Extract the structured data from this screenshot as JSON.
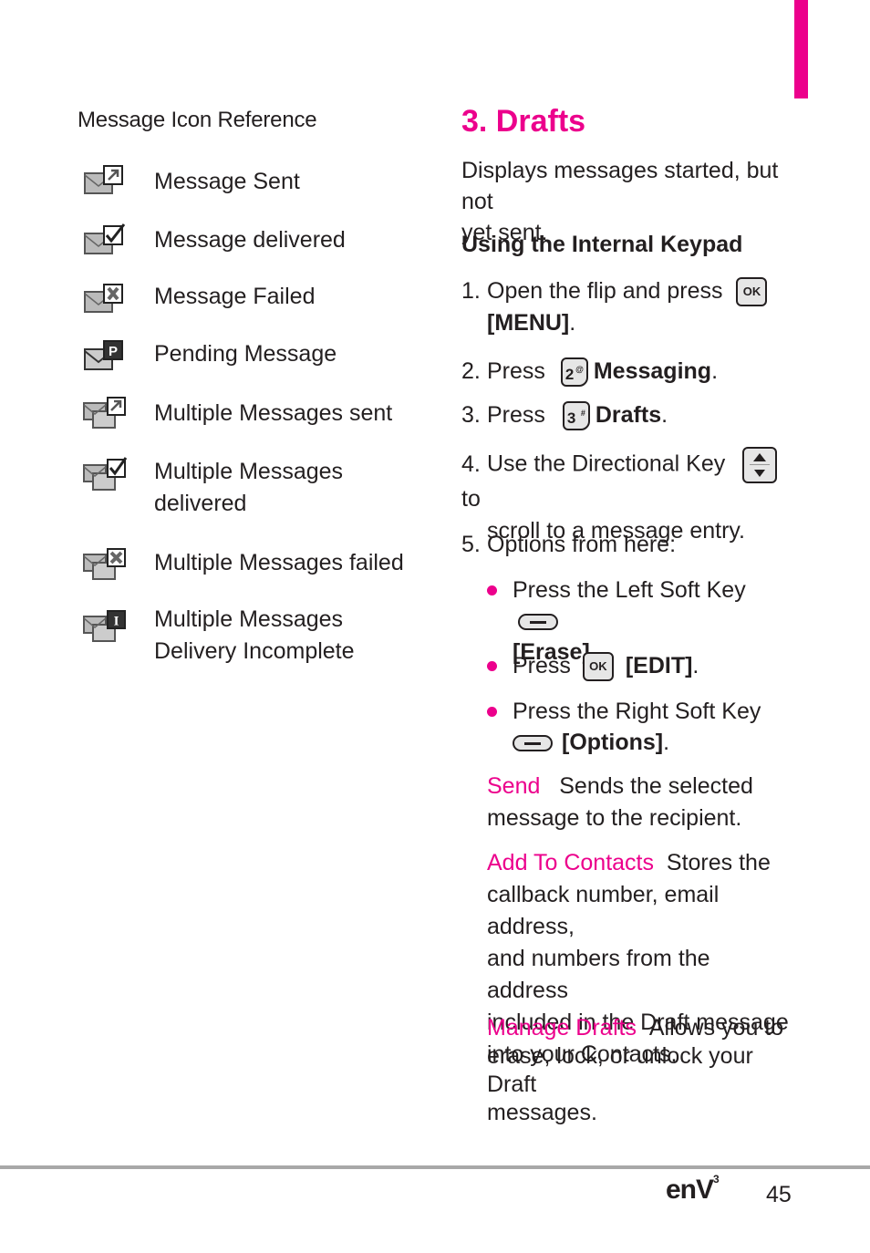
{
  "left": {
    "heading": "Message Icon Reference",
    "icons": [
      {
        "icon": "message-sent-icon",
        "label": "Message Sent"
      },
      {
        "icon": "message-delivered-icon",
        "label": "Message delivered"
      },
      {
        "icon": "message-failed-icon",
        "label": "Message Failed"
      },
      {
        "icon": "pending-message-icon",
        "label": "Pending Message"
      },
      {
        "icon": "multiple-messages-sent-icon",
        "label": "Multiple Messages sent"
      },
      {
        "icon": "multiple-messages-delivered-icon",
        "label_line1": "Multiple Messages",
        "label_line2": "delivered"
      },
      {
        "icon": "multiple-messages-failed-icon",
        "label": "Multiple Messages failed"
      },
      {
        "icon": "multiple-messages-incomplete-icon",
        "label_line1": "Multiple Messages",
        "label_line2": "Delivery Incomplete"
      }
    ]
  },
  "right": {
    "title": "3. Drafts",
    "intro_line1": "Displays messages started, but not",
    "intro_line2": "yet sent.",
    "subheading": "Using the Internal Keypad",
    "steps": [
      {
        "num": "1.",
        "text": "Open the flip and press",
        "key": "OK",
        "cont": "[MENU]",
        "end": "."
      },
      {
        "num": "2.",
        "text": "Press",
        "key": "2",
        "key_sup": "@",
        "bold": "Messaging",
        "end": "."
      },
      {
        "num": "3.",
        "text": "Press",
        "key": "3",
        "key_sup": "#",
        "bold": "Drafts",
        "end": "."
      },
      {
        "num": "4.",
        "text": "Use the Directional Key",
        "after": "to",
        "cont": "scroll to a message entry."
      },
      {
        "num": "5.",
        "text": "Options from here:"
      }
    ],
    "bullets": [
      {
        "text": "Press the Left Soft Key",
        "bold": "[Erase]",
        "end": "."
      },
      {
        "text": "Press",
        "key": "OK",
        "bold": "[EDIT]",
        "end": "."
      },
      {
        "text": "Press the Right Soft Key",
        "bold": "[Options]",
        "end": "."
      }
    ],
    "options": [
      {
        "term": "Send",
        "line1": "Sends the selected",
        "rest": [
          "message to the recipient."
        ]
      },
      {
        "term": "Add To Contacts",
        "line1": "Stores the",
        "rest": [
          "callback number, email address,",
          "and numbers from the address",
          "included in the Draft message",
          "into your Contacts."
        ]
      },
      {
        "term": "Manage Drafts",
        "line1": "Allows you to",
        "rest": [
          "erase, lock, or unlock your Draft",
          "messages."
        ]
      }
    ]
  },
  "footer": {
    "logo": "enV",
    "logo_sup": "3",
    "page_number": "45"
  },
  "colors": {
    "accent": "#ec008c",
    "text": "#231f20",
    "rule": "#a8a8a8"
  }
}
